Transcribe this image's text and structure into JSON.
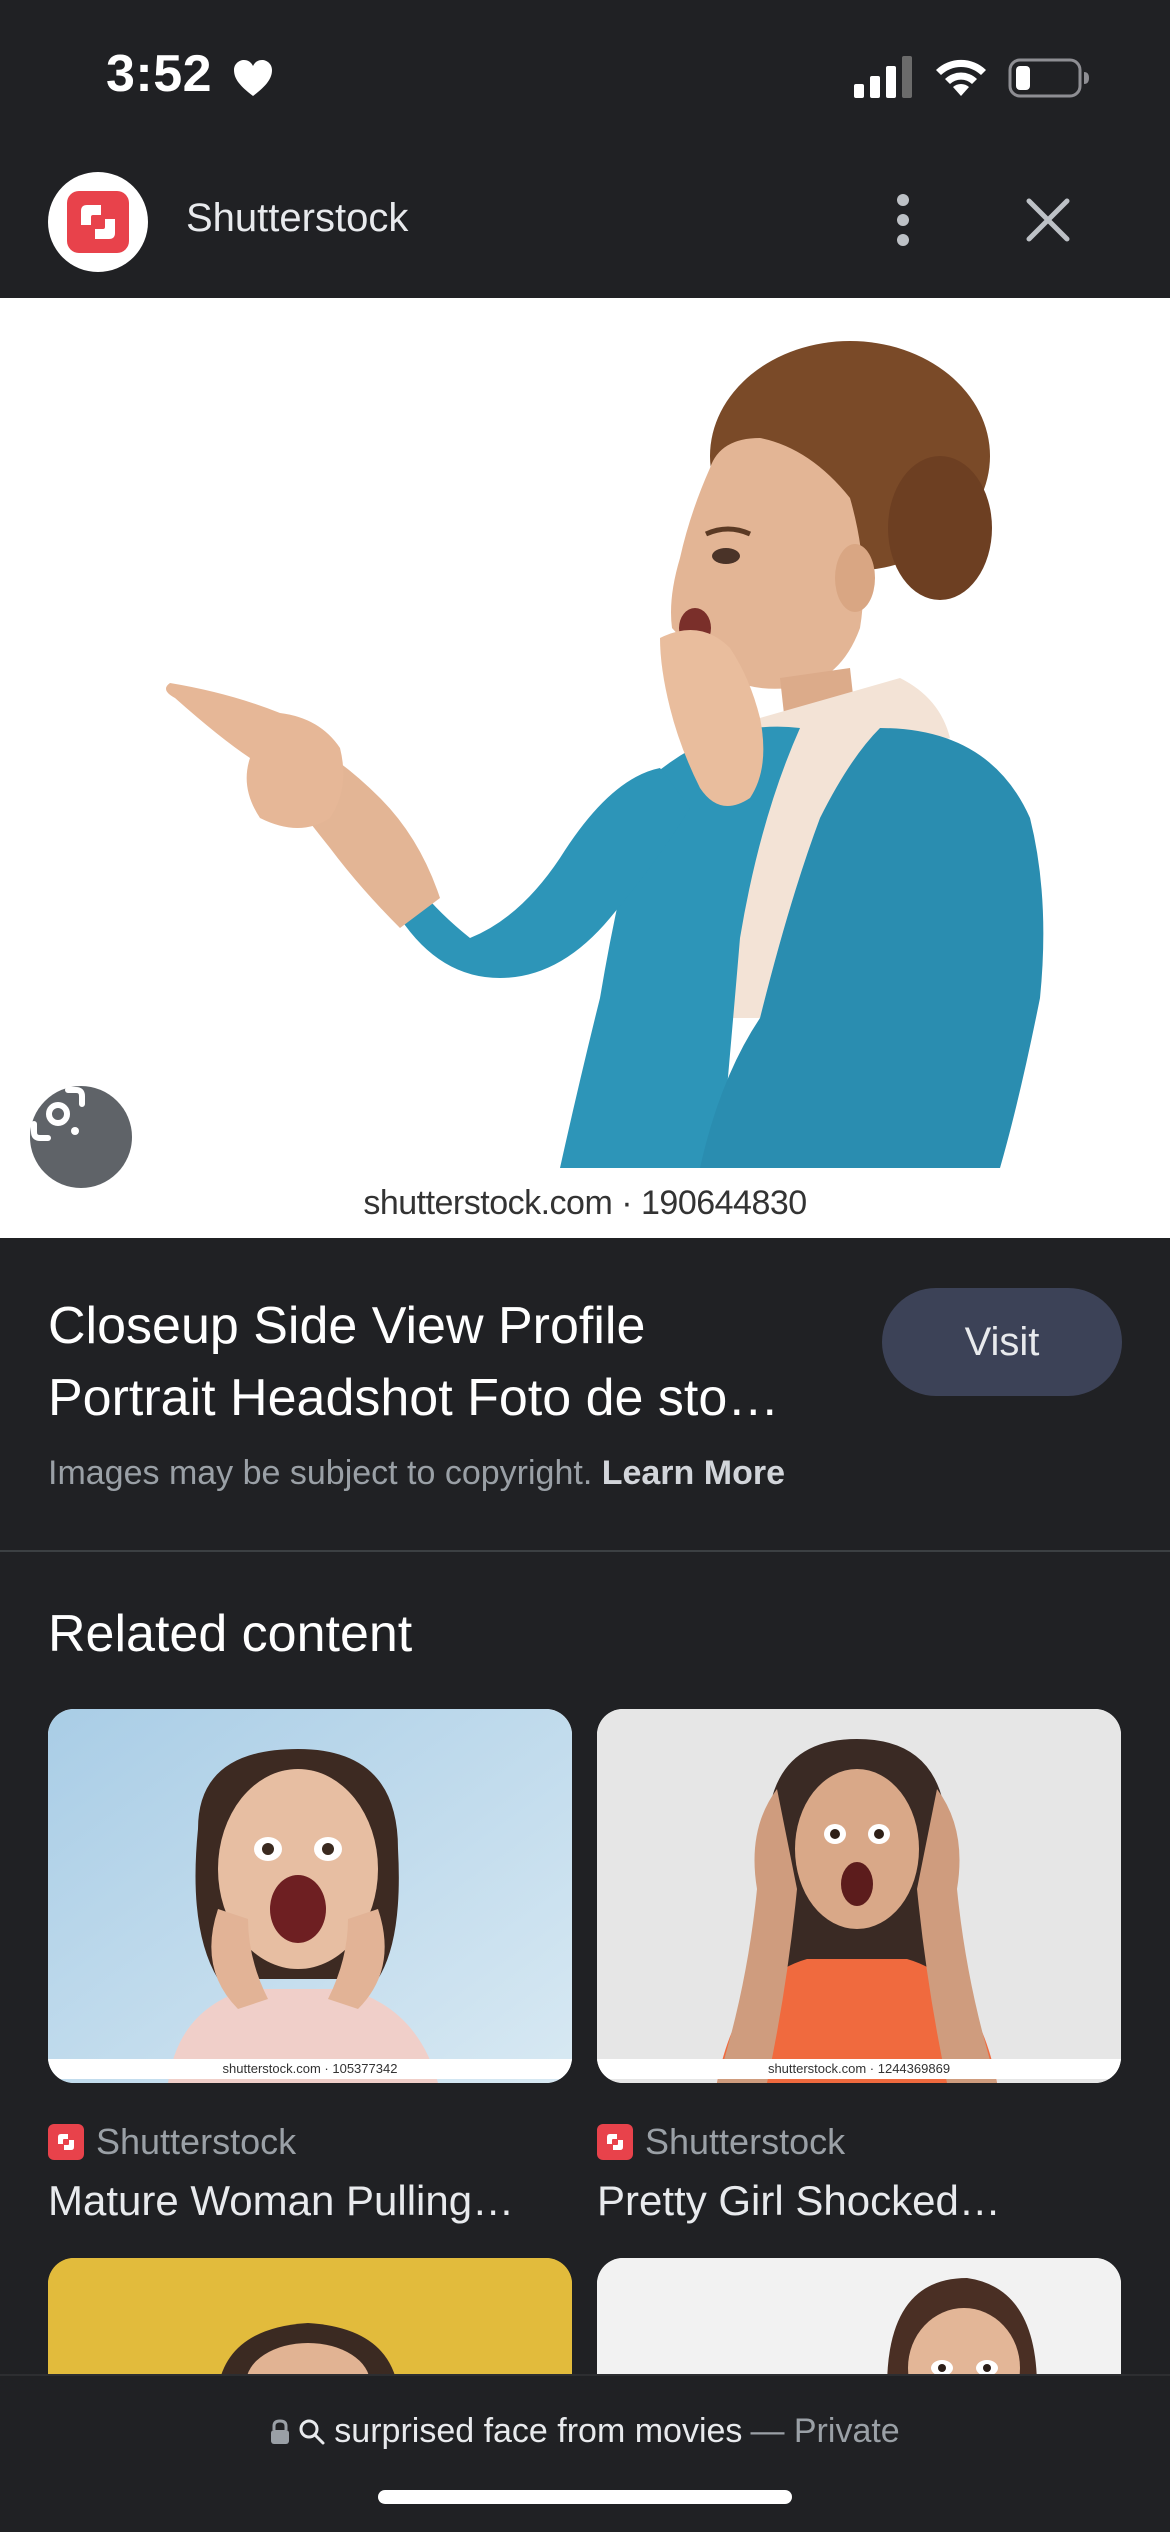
{
  "status_bar": {
    "time": "3:52"
  },
  "header": {
    "site_title": "Shutterstock",
    "brand_color": "#e8424b",
    "icons": [
      "more-vert-icon",
      "close-icon"
    ]
  },
  "hero": {
    "watermark": "shutterstock.com · 190644830"
  },
  "info": {
    "title_line1": "Closeup Side View Profile",
    "title_line2": "Portrait Headshot Foto de sto…",
    "visit_label": "Visit",
    "copyright_text": "Images may be subject to copyright.",
    "learn_more": "Learn More"
  },
  "related": {
    "heading": "Related content",
    "cards": [
      {
        "source": "Shutterstock",
        "caption": "Mature Woman Pulling…",
        "watermark": "shutterstock.com · 105377342"
      },
      {
        "source": "Shutterstock",
        "caption": "Pretty Girl Shocked…",
        "watermark": "shutterstock.com · 1244369869"
      }
    ]
  },
  "bottom_bar": {
    "url_text": "surprised face from movies",
    "url_suffix": "— Private"
  }
}
